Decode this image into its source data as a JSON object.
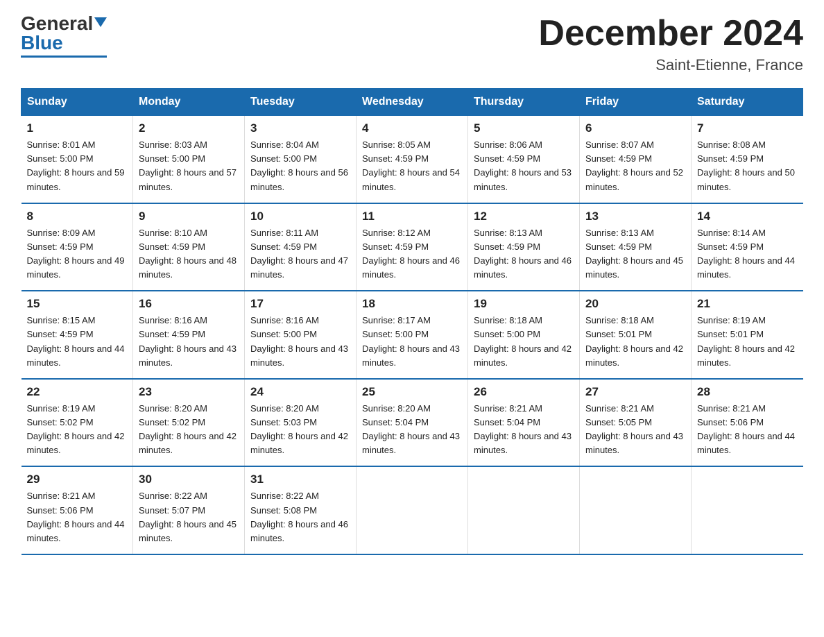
{
  "header": {
    "logo_general": "General",
    "logo_blue": "Blue",
    "month_title": "December 2024",
    "location": "Saint-Etienne, France"
  },
  "weekdays": [
    "Sunday",
    "Monday",
    "Tuesday",
    "Wednesday",
    "Thursday",
    "Friday",
    "Saturday"
  ],
  "weeks": [
    [
      {
        "day": "1",
        "sunrise": "8:01 AM",
        "sunset": "5:00 PM",
        "daylight": "8 hours and 59 minutes."
      },
      {
        "day": "2",
        "sunrise": "8:03 AM",
        "sunset": "5:00 PM",
        "daylight": "8 hours and 57 minutes."
      },
      {
        "day": "3",
        "sunrise": "8:04 AM",
        "sunset": "5:00 PM",
        "daylight": "8 hours and 56 minutes."
      },
      {
        "day": "4",
        "sunrise": "8:05 AM",
        "sunset": "4:59 PM",
        "daylight": "8 hours and 54 minutes."
      },
      {
        "day": "5",
        "sunrise": "8:06 AM",
        "sunset": "4:59 PM",
        "daylight": "8 hours and 53 minutes."
      },
      {
        "day": "6",
        "sunrise": "8:07 AM",
        "sunset": "4:59 PM",
        "daylight": "8 hours and 52 minutes."
      },
      {
        "day": "7",
        "sunrise": "8:08 AM",
        "sunset": "4:59 PM",
        "daylight": "8 hours and 50 minutes."
      }
    ],
    [
      {
        "day": "8",
        "sunrise": "8:09 AM",
        "sunset": "4:59 PM",
        "daylight": "8 hours and 49 minutes."
      },
      {
        "day": "9",
        "sunrise": "8:10 AM",
        "sunset": "4:59 PM",
        "daylight": "8 hours and 48 minutes."
      },
      {
        "day": "10",
        "sunrise": "8:11 AM",
        "sunset": "4:59 PM",
        "daylight": "8 hours and 47 minutes."
      },
      {
        "day": "11",
        "sunrise": "8:12 AM",
        "sunset": "4:59 PM",
        "daylight": "8 hours and 46 minutes."
      },
      {
        "day": "12",
        "sunrise": "8:13 AM",
        "sunset": "4:59 PM",
        "daylight": "8 hours and 46 minutes."
      },
      {
        "day": "13",
        "sunrise": "8:13 AM",
        "sunset": "4:59 PM",
        "daylight": "8 hours and 45 minutes."
      },
      {
        "day": "14",
        "sunrise": "8:14 AM",
        "sunset": "4:59 PM",
        "daylight": "8 hours and 44 minutes."
      }
    ],
    [
      {
        "day": "15",
        "sunrise": "8:15 AM",
        "sunset": "4:59 PM",
        "daylight": "8 hours and 44 minutes."
      },
      {
        "day": "16",
        "sunrise": "8:16 AM",
        "sunset": "4:59 PM",
        "daylight": "8 hours and 43 minutes."
      },
      {
        "day": "17",
        "sunrise": "8:16 AM",
        "sunset": "5:00 PM",
        "daylight": "8 hours and 43 minutes."
      },
      {
        "day": "18",
        "sunrise": "8:17 AM",
        "sunset": "5:00 PM",
        "daylight": "8 hours and 43 minutes."
      },
      {
        "day": "19",
        "sunrise": "8:18 AM",
        "sunset": "5:00 PM",
        "daylight": "8 hours and 42 minutes."
      },
      {
        "day": "20",
        "sunrise": "8:18 AM",
        "sunset": "5:01 PM",
        "daylight": "8 hours and 42 minutes."
      },
      {
        "day": "21",
        "sunrise": "8:19 AM",
        "sunset": "5:01 PM",
        "daylight": "8 hours and 42 minutes."
      }
    ],
    [
      {
        "day": "22",
        "sunrise": "8:19 AM",
        "sunset": "5:02 PM",
        "daylight": "8 hours and 42 minutes."
      },
      {
        "day": "23",
        "sunrise": "8:20 AM",
        "sunset": "5:02 PM",
        "daylight": "8 hours and 42 minutes."
      },
      {
        "day": "24",
        "sunrise": "8:20 AM",
        "sunset": "5:03 PM",
        "daylight": "8 hours and 42 minutes."
      },
      {
        "day": "25",
        "sunrise": "8:20 AM",
        "sunset": "5:04 PM",
        "daylight": "8 hours and 43 minutes."
      },
      {
        "day": "26",
        "sunrise": "8:21 AM",
        "sunset": "5:04 PM",
        "daylight": "8 hours and 43 minutes."
      },
      {
        "day": "27",
        "sunrise": "8:21 AM",
        "sunset": "5:05 PM",
        "daylight": "8 hours and 43 minutes."
      },
      {
        "day": "28",
        "sunrise": "8:21 AM",
        "sunset": "5:06 PM",
        "daylight": "8 hours and 44 minutes."
      }
    ],
    [
      {
        "day": "29",
        "sunrise": "8:21 AM",
        "sunset": "5:06 PM",
        "daylight": "8 hours and 44 minutes."
      },
      {
        "day": "30",
        "sunrise": "8:22 AM",
        "sunset": "5:07 PM",
        "daylight": "8 hours and 45 minutes."
      },
      {
        "day": "31",
        "sunrise": "8:22 AM",
        "sunset": "5:08 PM",
        "daylight": "8 hours and 46 minutes."
      },
      null,
      null,
      null,
      null
    ]
  ]
}
